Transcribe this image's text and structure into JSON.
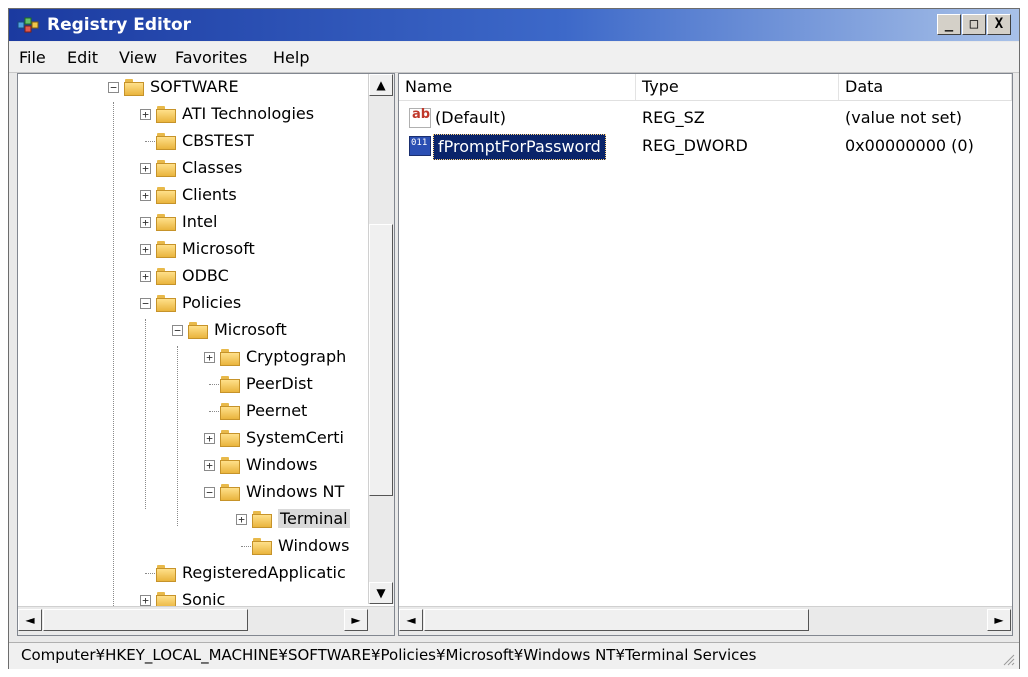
{
  "window": {
    "title": "Registry Editor",
    "controls": {
      "minimize": "_",
      "maximize": "□",
      "close": "X"
    }
  },
  "menu": {
    "items": [
      {
        "label": "File"
      },
      {
        "label": "Edit"
      },
      {
        "label": "View"
      },
      {
        "label": "Favorites"
      },
      {
        "label": "Help"
      }
    ]
  },
  "tree": {
    "nodes": [
      {
        "label": "SOFTWARE",
        "expander": "−"
      },
      {
        "label": "ATI Technologies",
        "expander": "+"
      },
      {
        "label": "CBSTEST",
        "expander": ""
      },
      {
        "label": "Classes",
        "expander": "+"
      },
      {
        "label": "Clients",
        "expander": "+"
      },
      {
        "label": "Intel",
        "expander": "+"
      },
      {
        "label": "Microsoft",
        "expander": "+"
      },
      {
        "label": "ODBC",
        "expander": "+"
      },
      {
        "label": "Policies",
        "expander": "−"
      },
      {
        "label": "Microsoft",
        "expander": "−"
      },
      {
        "label": "Cryptograph",
        "expander": "+"
      },
      {
        "label": "PeerDist",
        "expander": ""
      },
      {
        "label": "Peernet",
        "expander": ""
      },
      {
        "label": "SystemCerti",
        "expander": "+"
      },
      {
        "label": "Windows",
        "expander": "+"
      },
      {
        "label": "Windows NT",
        "expander": "−"
      },
      {
        "label": "Terminal",
        "expander": "+"
      },
      {
        "label": "Windows",
        "expander": ""
      },
      {
        "label": "RegisteredApplicatic",
        "expander": ""
      },
      {
        "label": "Sonic",
        "expander": "+"
      }
    ]
  },
  "values": {
    "columns": [
      {
        "label": "Name"
      },
      {
        "label": "Type"
      },
      {
        "label": "Data"
      }
    ],
    "rows": [
      {
        "name": "(Default)",
        "type": "REG_SZ",
        "data": "(value not set)",
        "icon": "string-value-icon",
        "icon_text": "ab",
        "selected": false
      },
      {
        "name": "fPromptForPassword",
        "type": "REG_DWORD",
        "data": "0x00000000 (0)",
        "icon": "binary-value-icon",
        "icon_text": "011",
        "selected": true
      }
    ]
  },
  "scrollbars": {
    "up": "▲",
    "down": "▼",
    "left": "◄",
    "right": "►"
  },
  "status": {
    "path": "Computer¥HKEY_LOCAL_MACHINE¥SOFTWARE¥Policies¥Microsoft¥Windows NT¥Terminal Services"
  },
  "colors": {
    "title_gradient_start": "#1b3aa0",
    "selection": "#0a246a",
    "folder": "#e9b43d"
  }
}
